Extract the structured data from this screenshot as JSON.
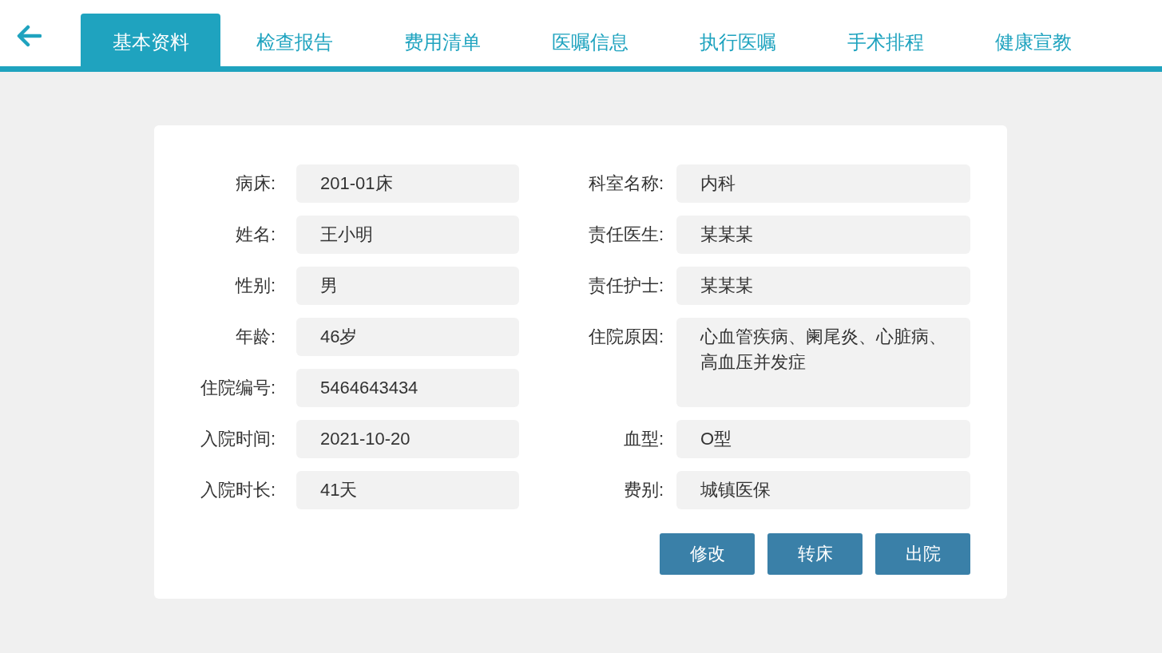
{
  "tabs": [
    {
      "label": "基本资料",
      "selected": true
    },
    {
      "label": "检查报告",
      "selected": false
    },
    {
      "label": "费用清单",
      "selected": false
    },
    {
      "label": "医嘱信息",
      "selected": false
    },
    {
      "label": "执行医嘱",
      "selected": false
    },
    {
      "label": "手术排程",
      "selected": false
    },
    {
      "label": "健康宣教",
      "selected": false
    }
  ],
  "left_fields": [
    {
      "label": "病床:",
      "value": "201-01床"
    },
    {
      "label": "姓名:",
      "value": "王小明"
    },
    {
      "label": "性别:",
      "value": "男"
    },
    {
      "label": "年龄:",
      "value": "46岁"
    },
    {
      "label": "住院编号:",
      "value": "5464643434"
    },
    {
      "label": "入院时间:",
      "value": "2021-10-20"
    },
    {
      "label": "入院时长:",
      "value": "41天"
    }
  ],
  "right_fields": [
    {
      "label": "科室名称:",
      "value": "内科",
      "kind": "single"
    },
    {
      "label": "责任医生:",
      "value": "某某某",
      "kind": "single"
    },
    {
      "label": "责任护士:",
      "value": "某某某",
      "kind": "single"
    },
    {
      "label": "住院原因:",
      "value": "心血管疾病、阑尾炎、心脏病、高血压并发症",
      "kind": "multiline"
    },
    {
      "label": "血型:",
      "value": "O型",
      "kind": "single"
    },
    {
      "label": "费别:",
      "value": "城镇医保",
      "kind": "single"
    }
  ],
  "buttons": [
    "修改",
    "转床",
    "出院"
  ]
}
